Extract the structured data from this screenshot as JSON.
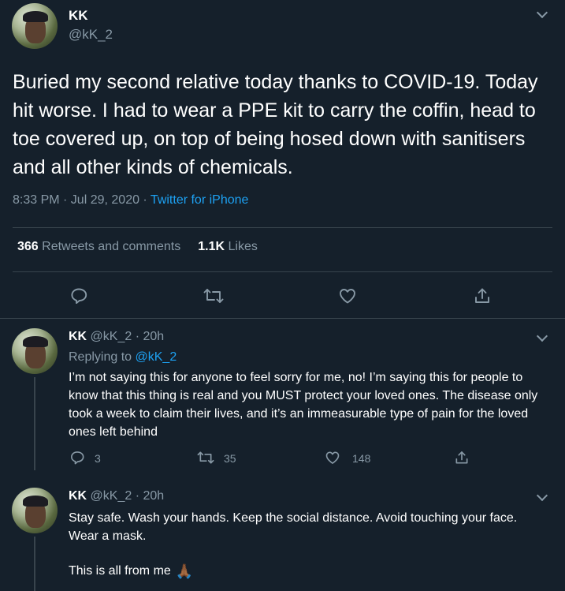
{
  "main_tweet": {
    "name": "KK",
    "handle": "@kK_2",
    "text": "Buried my second relative today thanks to COVID-19. Today hit worse. I had to wear a PPE kit to carry the coffin, head to toe covered up, on top of being hosed down with sanitisers and all other kinds of chemicals.",
    "timestamp": "8:33 PM · Jul 29, 2020 · ",
    "source": "Twitter for iPhone",
    "retweets_count": "366",
    "retweets_label": "Retweets and comments",
    "likes_count": "1.1K",
    "likes_label": "Likes"
  },
  "replies": [
    {
      "name": "KK",
      "handle_time": " @kK_2 · 20h",
      "replying_prefix": "Replying to ",
      "replying_to": "@kK_2",
      "text": "I’m not saying this for anyone to feel sorry for me, no! I’m saying this for people to know that this thing is real and you MUST protect your loved ones. The disease only took a week to claim their lives, and it’s an immeasurable type of pain for the loved ones left behind",
      "reply_count": "3",
      "retweet_count": "35",
      "like_count": "148"
    },
    {
      "name": "KK",
      "handle_time": " @kK_2 · 20h",
      "text_line1": "Stay safe. Wash your hands. Keep the social distance. Avoid touching your face. Wear a mask.",
      "text_line2": "This is all from me",
      "emoji": "🙏🏾"
    }
  ],
  "icons": {
    "reply": "reply-icon",
    "retweet": "retweet-icon",
    "like": "heart-icon",
    "share": "share-icon",
    "more": "chevron-down-icon"
  },
  "colors": {
    "background": "#15202b",
    "divider": "#38444d",
    "secondary_text": "#8899a6",
    "link": "#1da1f2"
  }
}
